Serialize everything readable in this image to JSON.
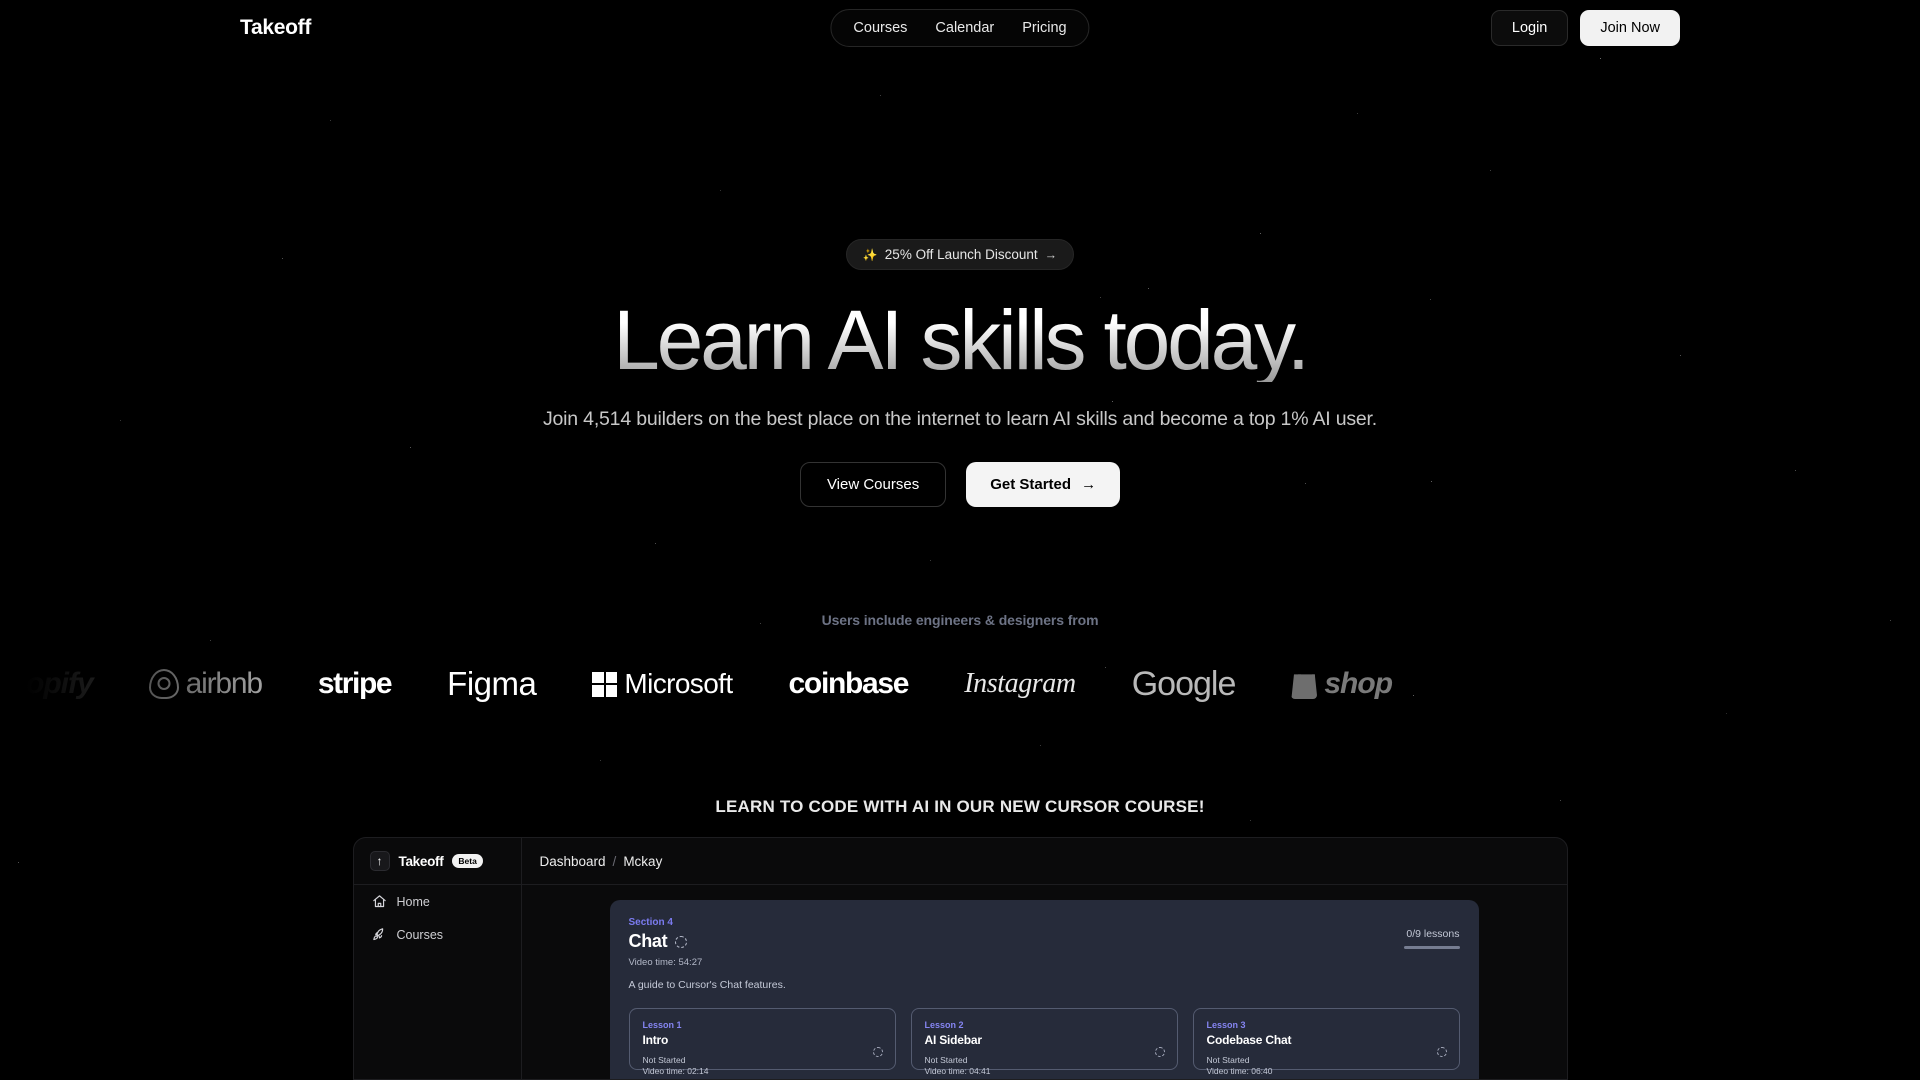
{
  "nav": {
    "brand": "Takeoff",
    "links": [
      {
        "label": "Courses"
      },
      {
        "label": "Calendar"
      },
      {
        "label": "Pricing"
      }
    ],
    "login_label": "Login",
    "join_label": "Join Now"
  },
  "hero": {
    "badge": {
      "sparkle": "✨",
      "text": "25% Off Launch Discount",
      "arrow": "→"
    },
    "headline": "Learn AI skills today.",
    "subheadline": "Join 4,514 builders on the best place on the internet to learn AI skills and become a top 1% AI user.",
    "cta_primary": "View Courses",
    "cta_secondary": "Get Started",
    "cta_secondary_arrow": "→"
  },
  "logos": {
    "caption": "Users include engineers & designers from",
    "items": [
      {
        "name": "shopify",
        "label": "shopify",
        "icon": "shopping-bag-icon"
      },
      {
        "name": "airbnb",
        "label": "airbnb",
        "icon": "airbnb-mark-icon"
      },
      {
        "name": "stripe",
        "label": "stripe",
        "icon": ""
      },
      {
        "name": "figma",
        "label": "Figma",
        "icon": ""
      },
      {
        "name": "microsoft",
        "label": "Microsoft",
        "icon": "microsoft-grid-icon"
      },
      {
        "name": "coinbase",
        "label": "coinbase",
        "icon": ""
      },
      {
        "name": "instagram",
        "label": "Instagram",
        "icon": ""
      },
      {
        "name": "google",
        "label": "Google",
        "icon": ""
      },
      {
        "name": "shopify2",
        "label": "shop",
        "icon": "shopping-bag-icon"
      }
    ]
  },
  "preview": {
    "title": "LEARN TO CODE WITH AI IN OUR NEW CURSOR COURSE!",
    "app": {
      "logo_glyph": "↑",
      "name": "Takeoff",
      "badge": "Beta",
      "breadcrumb": {
        "root": "Dashboard",
        "separator": "/",
        "leaf": "Mckay"
      },
      "sidebar": [
        {
          "label": "Home",
          "icon": "home-icon"
        },
        {
          "label": "Courses",
          "icon": "rocket-icon"
        }
      ]
    },
    "section": {
      "label": "Section 4",
      "title": "Chat",
      "video_time": "Video time: 54:27",
      "description": "A guide to Cursor's Chat features.",
      "lessons_progress": "0/9 lessons"
    },
    "lessons": [
      {
        "label": "Lesson 1",
        "title": "Intro",
        "status": "Not Started",
        "time": "Video time: 02:14"
      },
      {
        "label": "Lesson 2",
        "title": "AI Sidebar",
        "status": "Not Started",
        "time": "Video time: 04:41"
      },
      {
        "label": "Lesson 3",
        "title": "Codebase Chat",
        "status": "Not Started",
        "time": "Video time: 06:40"
      }
    ]
  },
  "colors": {
    "background": "#000000",
    "accent_purple": "#7b7bf0",
    "card_bg": "#262b3a",
    "cta_light": "#f4f4f4",
    "caption_gray": "#6d7385"
  }
}
